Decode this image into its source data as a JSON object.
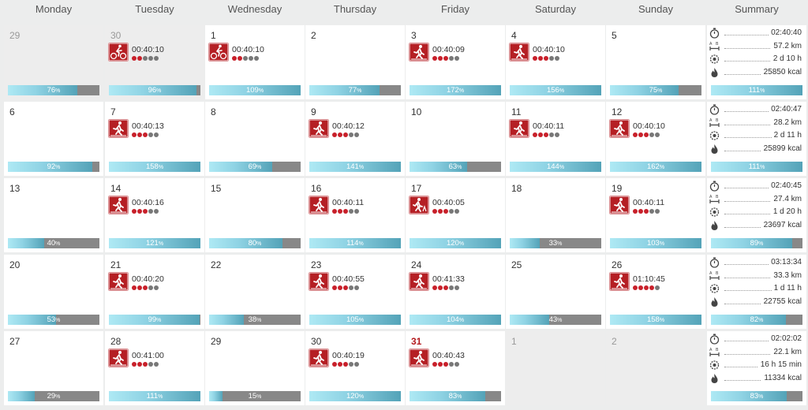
{
  "columns": [
    "Monday",
    "Tuesday",
    "Wednesday",
    "Thursday",
    "Friday",
    "Saturday",
    "Sunday",
    "Summary"
  ],
  "colors": {
    "activity": "#b51f24",
    "bar_fill": "#8fd3e4",
    "bar_track": "#888888",
    "effort_on": "#c8202a",
    "effort_off": "#777777",
    "today": "#b3191d"
  },
  "weeks": [
    {
      "days": [
        {
          "num": "29",
          "muted": true,
          "bar": {
            "value": 76,
            "label": "76%"
          }
        },
        {
          "num": "30",
          "muted": true,
          "activity": {
            "icon": "cycling-icon",
            "duration": "00:40:10",
            "effort": 2
          },
          "bar": {
            "value": 96,
            "label": "96%"
          }
        },
        {
          "num": "1",
          "activity": {
            "icon": "cycling-icon",
            "duration": "00:40:10",
            "effort": 2
          },
          "bar": {
            "value": 109,
            "label": "109%"
          }
        },
        {
          "num": "2",
          "bar": {
            "value": 77,
            "label": "77%"
          }
        },
        {
          "num": "3",
          "activity": {
            "icon": "running-icon",
            "duration": "00:40:09",
            "effort": 3
          },
          "bar": {
            "value": 172,
            "label": "172%"
          }
        },
        {
          "num": "4",
          "activity": {
            "icon": "running-icon",
            "duration": "00:40:10",
            "effort": 3
          },
          "bar": {
            "value": 156,
            "label": "156%"
          }
        },
        {
          "num": "5",
          "bar": {
            "value": 75,
            "label": "75%"
          }
        }
      ],
      "summary": {
        "time": "02:40:40",
        "distance": "57.2 km",
        "recovery": "2 d 10 h",
        "calories": "25850 kcal",
        "bar": {
          "value": 111,
          "label": "111%"
        }
      }
    },
    {
      "days": [
        {
          "num": "6",
          "bar": {
            "value": 92,
            "label": "92%"
          }
        },
        {
          "num": "7",
          "activity": {
            "icon": "running-icon",
            "duration": "00:40:13",
            "effort": 3
          },
          "bar": {
            "value": 158,
            "label": "158%"
          }
        },
        {
          "num": "8",
          "bar": {
            "value": 69,
            "label": "69%"
          }
        },
        {
          "num": "9",
          "activity": {
            "icon": "running-icon",
            "duration": "00:40:12",
            "effort": 3
          },
          "bar": {
            "value": 141,
            "label": "141%"
          }
        },
        {
          "num": "10",
          "bar": {
            "value": 63,
            "label": "63%"
          }
        },
        {
          "num": "11",
          "activity": {
            "icon": "running-icon",
            "duration": "00:40:11",
            "effort": 3
          },
          "bar": {
            "value": 144,
            "label": "144%"
          }
        },
        {
          "num": "12",
          "activity": {
            "icon": "running-icon",
            "duration": "00:40:10",
            "effort": 3
          },
          "bar": {
            "value": 162,
            "label": "162%"
          }
        }
      ],
      "summary": {
        "time": "02:40:47",
        "distance": "28.2 km",
        "recovery": "2 d 11 h",
        "calories": "25899 kcal",
        "bar": {
          "value": 111,
          "label": "111%"
        }
      }
    },
    {
      "days": [
        {
          "num": "13",
          "bar": {
            "value": 40,
            "label": "40%"
          }
        },
        {
          "num": "14",
          "activity": {
            "icon": "running-icon",
            "duration": "00:40:16",
            "effort": 3
          },
          "bar": {
            "value": 121,
            "label": "121%"
          }
        },
        {
          "num": "15",
          "bar": {
            "value": 80,
            "label": "80%"
          }
        },
        {
          "num": "16",
          "activity": {
            "icon": "running-icon",
            "duration": "00:40:11",
            "effort": 3
          },
          "bar": {
            "value": 114,
            "label": "114%"
          }
        },
        {
          "num": "17",
          "activity": {
            "icon": "trail-running-icon",
            "duration": "00:40:05",
            "effort": 3
          },
          "bar": {
            "value": 120,
            "label": "120%"
          }
        },
        {
          "num": "18",
          "bar": {
            "value": 33,
            "label": "33%"
          }
        },
        {
          "num": "19",
          "activity": {
            "icon": "running-icon",
            "duration": "00:40:11",
            "effort": 3
          },
          "bar": {
            "value": 103,
            "label": "103%"
          }
        }
      ],
      "summary": {
        "time": "02:40:45",
        "distance": "27.4 km",
        "recovery": "1 d 20 h",
        "calories": "23697 kcal",
        "bar": {
          "value": 89,
          "label": "89%"
        }
      }
    },
    {
      "days": [
        {
          "num": "20",
          "bar": {
            "value": 53,
            "label": "53%"
          }
        },
        {
          "num": "21",
          "activity": {
            "icon": "running-icon",
            "duration": "00:40:20",
            "effort": 3
          },
          "bar": {
            "value": 99,
            "label": "99%"
          }
        },
        {
          "num": "22",
          "bar": {
            "value": 38,
            "label": "38%"
          }
        },
        {
          "num": "23",
          "activity": {
            "icon": "running-icon",
            "duration": "00:40:55",
            "effort": 3
          },
          "bar": {
            "value": 105,
            "label": "105%"
          }
        },
        {
          "num": "24",
          "activity": {
            "icon": "running-icon",
            "duration": "00:41:33",
            "effort": 3
          },
          "bar": {
            "value": 104,
            "label": "104%"
          }
        },
        {
          "num": "25",
          "bar": {
            "value": 43,
            "label": "43%"
          }
        },
        {
          "num": "26",
          "activity": {
            "icon": "running-icon",
            "duration": "01:10:45",
            "effort": 4
          },
          "bar": {
            "value": 158,
            "label": "158%"
          }
        }
      ],
      "summary": {
        "time": "03:13:34",
        "distance": "33.3 km",
        "recovery": "1 d 11 h",
        "calories": "22755 kcal",
        "bar": {
          "value": 82,
          "label": "82%"
        }
      }
    },
    {
      "days": [
        {
          "num": "27",
          "bar": {
            "value": 29,
            "label": "29%"
          }
        },
        {
          "num": "28",
          "activity": {
            "icon": "running-icon",
            "duration": "00:41:00",
            "effort": 3
          },
          "bar": {
            "value": 111,
            "label": "111%"
          }
        },
        {
          "num": "29",
          "bar": {
            "value": 15,
            "label": "15%"
          }
        },
        {
          "num": "30",
          "activity": {
            "icon": "running-icon",
            "duration": "00:40:19",
            "effort": 3
          },
          "bar": {
            "value": 120,
            "label": "120%"
          }
        },
        {
          "num": "31",
          "today": true,
          "activity": {
            "icon": "running-icon",
            "duration": "00:40:43",
            "effort": 3
          },
          "bar": {
            "value": 83,
            "label": "83%"
          }
        },
        {
          "num": "1",
          "muted": true
        },
        {
          "num": "2",
          "muted": true
        }
      ],
      "summary": {
        "time": "02:02:02",
        "distance": "22.1 km",
        "recovery": "16 h 15 min",
        "calories": "11334 kcal",
        "bar": {
          "value": 83,
          "label": "83%"
        }
      }
    }
  ]
}
